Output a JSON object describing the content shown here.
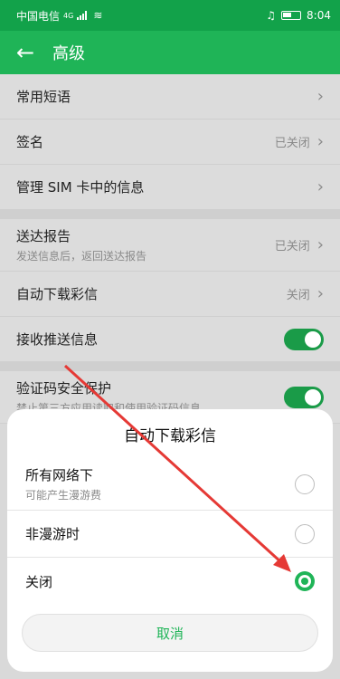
{
  "statusbar": {
    "carrier": "中国电信",
    "network": "4G",
    "time": "8:04"
  },
  "header": {
    "title": "高级"
  },
  "settings": {
    "common_phrases": "常用短语",
    "signature": {
      "label": "签名",
      "value": "已关闭"
    },
    "manage_sim": "管理 SIM 卡中的信息",
    "delivery_report": {
      "label": "送达报告",
      "sub": "发送信息后，返回送达报告",
      "value": "已关闭"
    },
    "auto_download": {
      "label": "自动下载彩信",
      "value": "关闭"
    },
    "push_messages": {
      "label": "接收推送信息",
      "on": true
    },
    "code_protect": {
      "label": "验证码安全保护",
      "sub": "禁止第三方应用读取和使用验证码信息",
      "on": true
    }
  },
  "sheet": {
    "title": "自动下载彩信",
    "options": [
      {
        "label": "所有网络下",
        "sub": "可能产生漫游费",
        "selected": false
      },
      {
        "label": "非漫游时",
        "sub": "",
        "selected": false
      },
      {
        "label": "关闭",
        "sub": "",
        "selected": true
      }
    ],
    "cancel": "取消"
  },
  "colors": {
    "accent": "#1fb457",
    "annotation": "#e53935"
  }
}
